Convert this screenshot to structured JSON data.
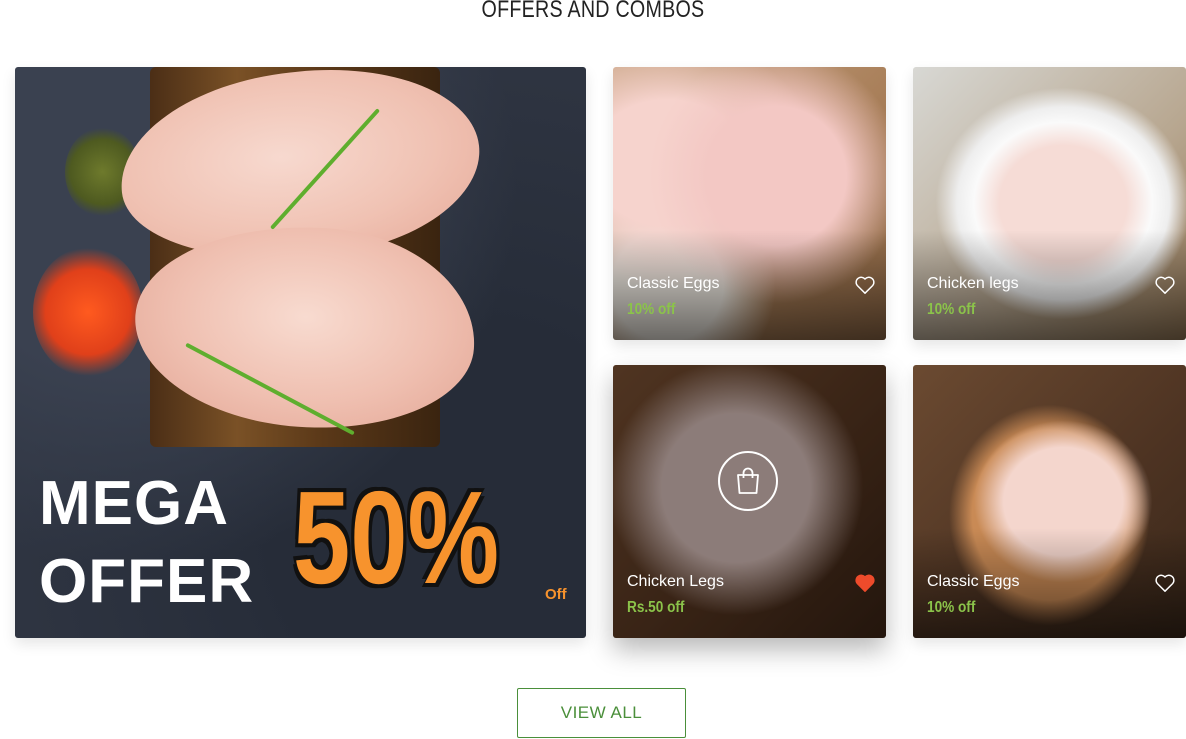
{
  "section": {
    "title": "OFFERS AND COMBOS"
  },
  "banner": {
    "line1": "MEGA",
    "line2": "OFFER",
    "percent": "50%",
    "off": "Off"
  },
  "products": [
    {
      "name": "Classic Eggs",
      "offer": "10% off",
      "favorite": false
    },
    {
      "name": "Chicken legs",
      "offer": "10% off",
      "favorite": false
    },
    {
      "name": "Chicken Legs",
      "offer": "Rs.50 off",
      "favorite": true
    },
    {
      "name": "Classic Eggs",
      "offer": "10% off",
      "favorite": false
    }
  ],
  "icons": {
    "heart": "heart-icon",
    "bag": "shopping-bag-icon"
  },
  "colors": {
    "offer_green": "#8bc34a",
    "button_green": "#4a8f3a",
    "favorite_red": "#ee4b2b",
    "banner_orange": "#f7932d"
  },
  "actions": {
    "view_all": "VIEW ALL"
  }
}
